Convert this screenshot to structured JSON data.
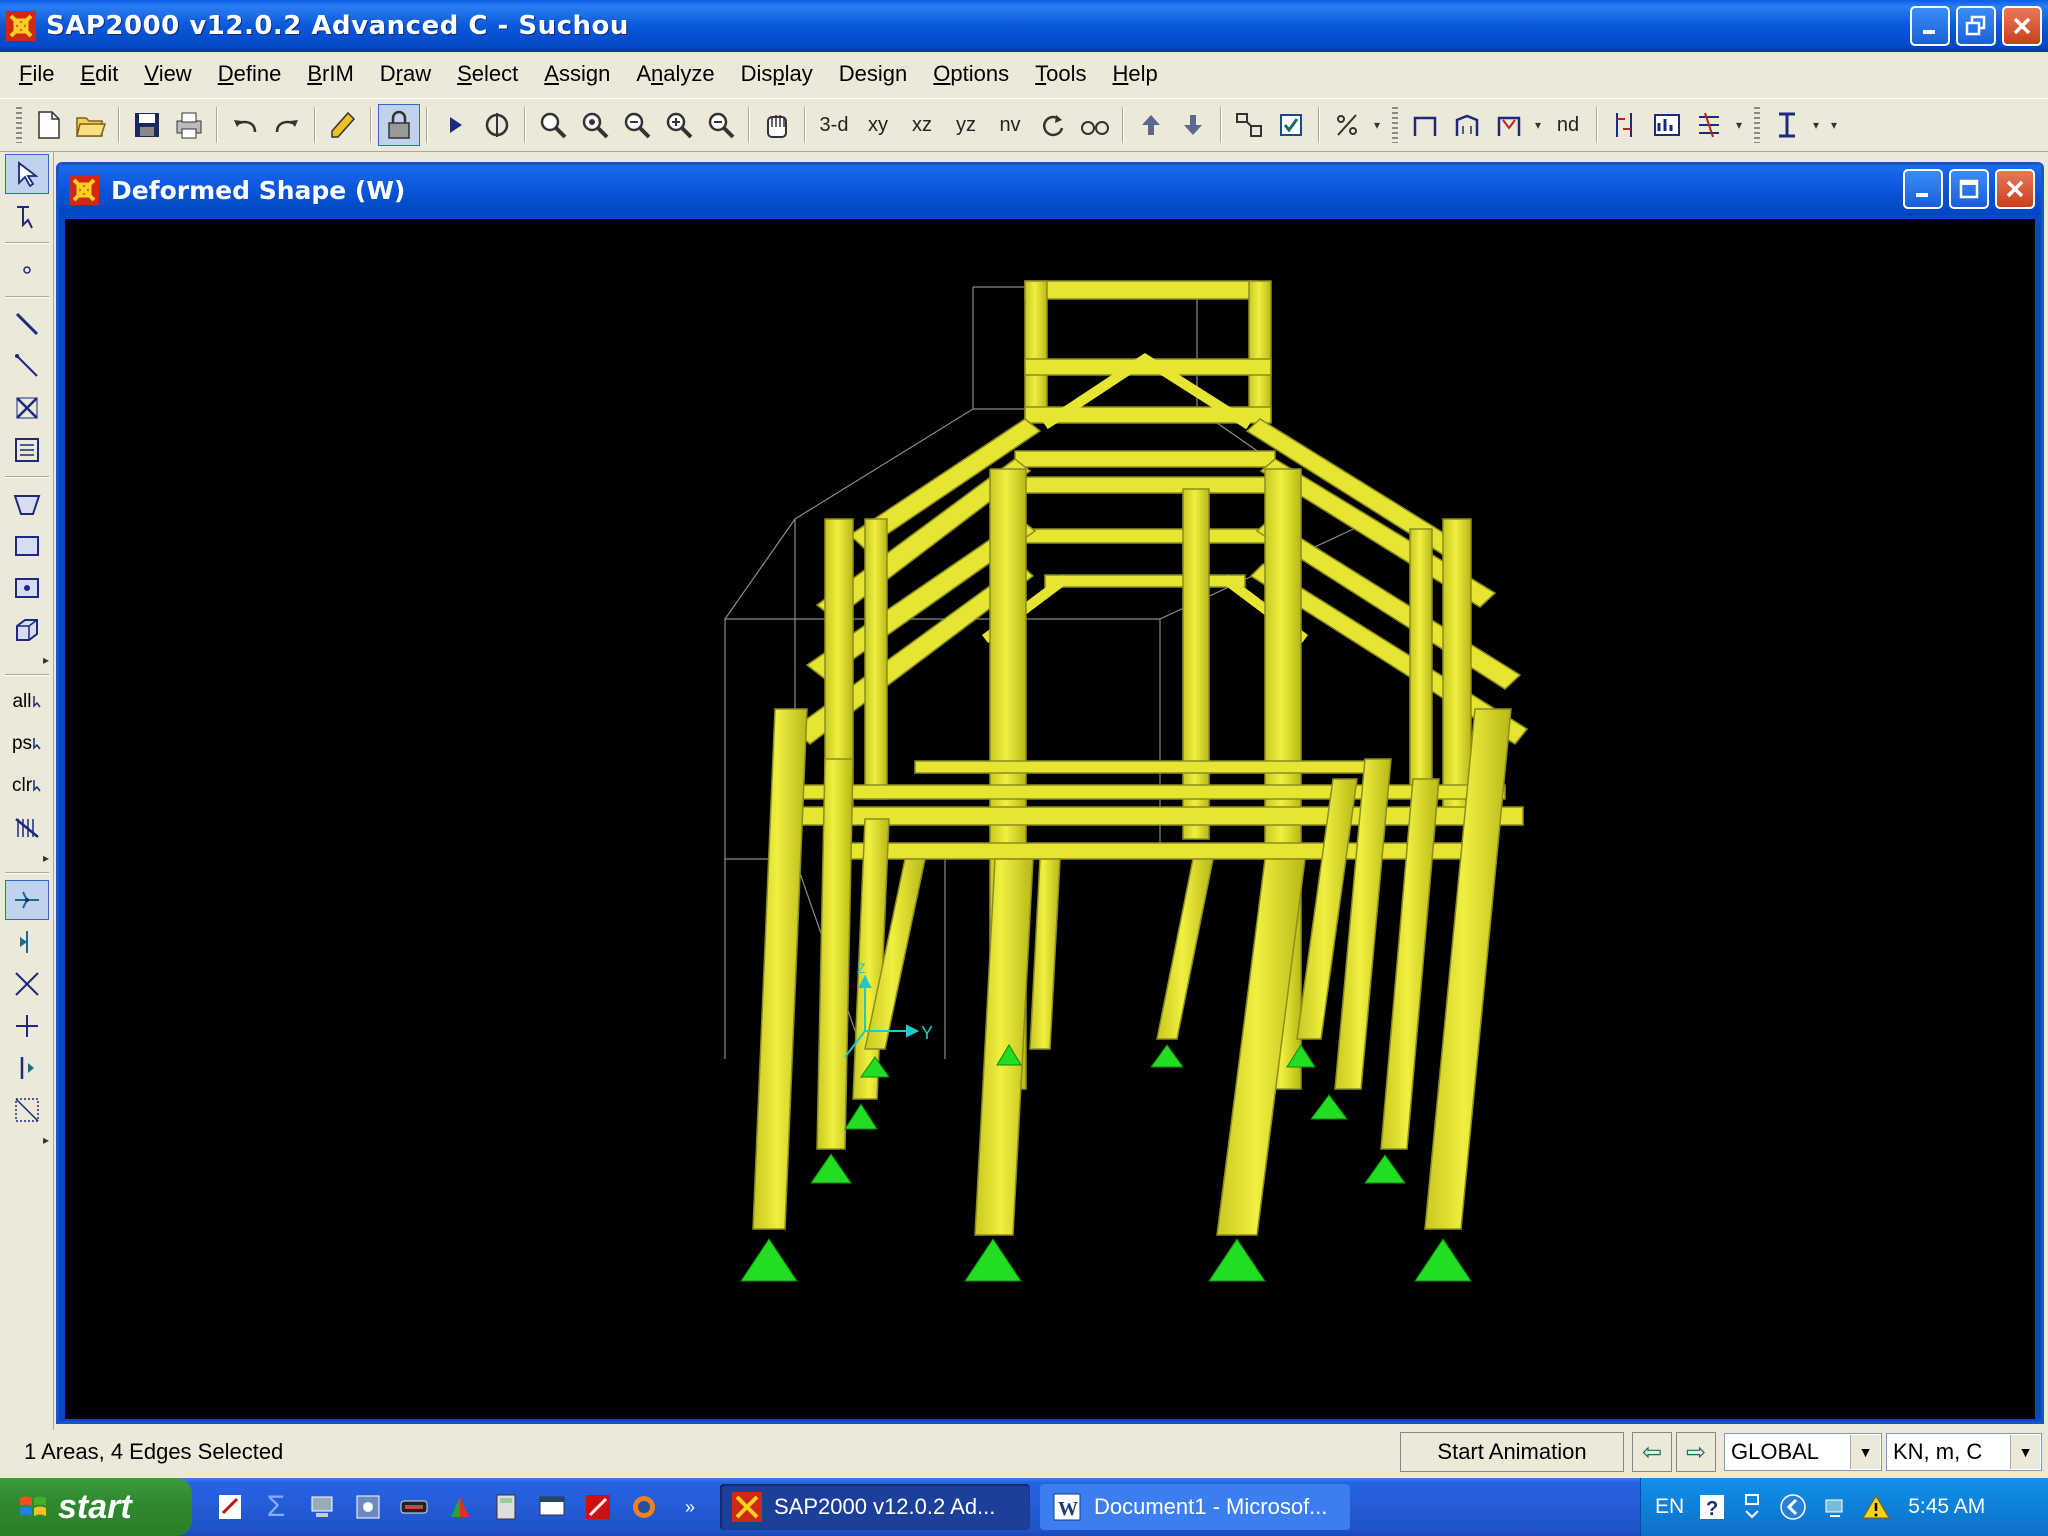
{
  "app": {
    "title": "SAP2000 v12.0.2 Advanced C  - Suchou"
  },
  "menu": {
    "items": [
      {
        "label": "File",
        "accel": "F"
      },
      {
        "label": "Edit",
        "accel": "E"
      },
      {
        "label": "View",
        "accel": "V"
      },
      {
        "label": "Define",
        "accel": "D"
      },
      {
        "label": "BrIM",
        "accel": "B"
      },
      {
        "label": "Draw",
        "accel": "r"
      },
      {
        "label": "Select",
        "accel": "S"
      },
      {
        "label": "Assign",
        "accel": "A"
      },
      {
        "label": "Analyze",
        "accel": "n"
      },
      {
        "label": "Display",
        "accel": "p"
      },
      {
        "label": "Design",
        "accel": "g"
      },
      {
        "label": "Options",
        "accel": "O"
      },
      {
        "label": "Tools",
        "accel": "T"
      },
      {
        "label": "Help",
        "accel": "H"
      }
    ]
  },
  "toolbar": {
    "view_3d": "3-d",
    "view_xy": "xy",
    "view_xz": "xz",
    "view_yz": "yz",
    "view_nv": "nv",
    "nd": "nd"
  },
  "leftbar": {
    "all": "all",
    "ps": "ps",
    "clr": "clr"
  },
  "child_window": {
    "title": "Deformed Shape (W)"
  },
  "viewport": {
    "axis_y": "Y",
    "axis_z": "Z",
    "background": "#000000",
    "member_color": "#e6e632",
    "support_color": "#22dd22"
  },
  "status": {
    "selection": "1 Areas, 4 Edges Selected",
    "animation_button": "Start Animation",
    "coord_system": "GLOBAL",
    "units": "KN, m, C"
  },
  "taskbar": {
    "start": "start",
    "tasks": [
      {
        "label": "SAP2000 v12.0.2 Ad...",
        "active": true
      },
      {
        "label": "Document1 - Microsof...",
        "active": false
      }
    ],
    "lang": "EN",
    "clock": "5:45 AM"
  }
}
